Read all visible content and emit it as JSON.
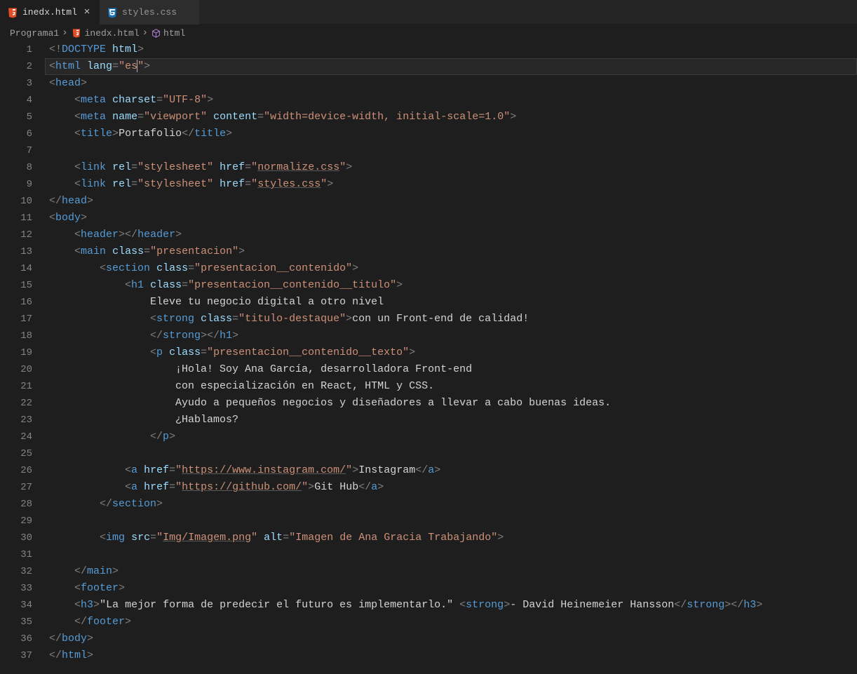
{
  "tabs": [
    {
      "label": "inedx.html",
      "active": true,
      "icon": "html5"
    },
    {
      "label": "styles.css",
      "active": false,
      "icon": "css3"
    }
  ],
  "breadcrumbs": {
    "parts": [
      "Programa1",
      "inedx.html",
      "html"
    ]
  },
  "code": {
    "lines": [
      {
        "n": 1,
        "indent": 0,
        "segs": [
          [
            "p",
            "<!"
          ],
          [
            "tag",
            "DOCTYPE"
          ],
          [
            "txt",
            " "
          ],
          [
            "attr",
            "html"
          ],
          [
            "p",
            ">"
          ]
        ]
      },
      {
        "n": 2,
        "indent": 0,
        "hl": true,
        "segs": [
          [
            "p",
            "<"
          ],
          [
            "tag",
            "html"
          ],
          [
            "txt",
            " "
          ],
          [
            "attr",
            "lang"
          ],
          [
            "p",
            "="
          ],
          [
            "str",
            "\"es"
          ],
          [
            "caret",
            ""
          ],
          [
            "str",
            "\""
          ],
          [
            "p",
            ">"
          ]
        ]
      },
      {
        "n": 3,
        "indent": 0,
        "segs": [
          [
            "p",
            "<"
          ],
          [
            "tag",
            "head"
          ],
          [
            "p",
            ">"
          ]
        ]
      },
      {
        "n": 4,
        "indent": 1,
        "segs": [
          [
            "p",
            "<"
          ],
          [
            "tag",
            "meta"
          ],
          [
            "txt",
            " "
          ],
          [
            "attr",
            "charset"
          ],
          [
            "p",
            "="
          ],
          [
            "str",
            "\"UTF-8\""
          ],
          [
            "p",
            ">"
          ]
        ]
      },
      {
        "n": 5,
        "indent": 1,
        "segs": [
          [
            "p",
            "<"
          ],
          [
            "tag",
            "meta"
          ],
          [
            "txt",
            " "
          ],
          [
            "attr",
            "name"
          ],
          [
            "p",
            "="
          ],
          [
            "str",
            "\"viewport\""
          ],
          [
            "txt",
            " "
          ],
          [
            "attr",
            "content"
          ],
          [
            "p",
            "="
          ],
          [
            "str",
            "\"width=device-width, initial-scale=1.0\""
          ],
          [
            "p",
            ">"
          ]
        ]
      },
      {
        "n": 6,
        "indent": 1,
        "segs": [
          [
            "p",
            "<"
          ],
          [
            "tag",
            "title"
          ],
          [
            "p",
            ">"
          ],
          [
            "txt",
            "Portafolio"
          ],
          [
            "p",
            "</"
          ],
          [
            "tag",
            "title"
          ],
          [
            "p",
            ">"
          ]
        ]
      },
      {
        "n": 7,
        "indent": 0,
        "segs": []
      },
      {
        "n": 8,
        "indent": 1,
        "segs": [
          [
            "p",
            "<"
          ],
          [
            "tag",
            "link"
          ],
          [
            "txt",
            " "
          ],
          [
            "attr",
            "rel"
          ],
          [
            "p",
            "="
          ],
          [
            "str",
            "\"stylesheet\""
          ],
          [
            "txt",
            " "
          ],
          [
            "attr",
            "href"
          ],
          [
            "p",
            "="
          ],
          [
            "str",
            "\""
          ],
          [
            "link",
            "normalize.css"
          ],
          [
            "str",
            "\""
          ],
          [
            "p",
            ">"
          ]
        ]
      },
      {
        "n": 9,
        "indent": 1,
        "segs": [
          [
            "p",
            "<"
          ],
          [
            "tag",
            "link"
          ],
          [
            "txt",
            " "
          ],
          [
            "attr",
            "rel"
          ],
          [
            "p",
            "="
          ],
          [
            "str",
            "\"stylesheet\""
          ],
          [
            "txt",
            " "
          ],
          [
            "attr",
            "href"
          ],
          [
            "p",
            "="
          ],
          [
            "str",
            "\""
          ],
          [
            "link",
            "styles.css"
          ],
          [
            "str",
            "\""
          ],
          [
            "p",
            ">"
          ]
        ]
      },
      {
        "n": 10,
        "indent": 0,
        "segs": [
          [
            "p",
            "</"
          ],
          [
            "tag",
            "head"
          ],
          [
            "p",
            ">"
          ]
        ]
      },
      {
        "n": 11,
        "indent": 0,
        "segs": [
          [
            "p",
            "<"
          ],
          [
            "tag",
            "body"
          ],
          [
            "p",
            ">"
          ]
        ]
      },
      {
        "n": 12,
        "indent": 1,
        "segs": [
          [
            "p",
            "<"
          ],
          [
            "tag",
            "header"
          ],
          [
            "p",
            "></"
          ],
          [
            "tag",
            "header"
          ],
          [
            "p",
            ">"
          ]
        ]
      },
      {
        "n": 13,
        "indent": 1,
        "segs": [
          [
            "p",
            "<"
          ],
          [
            "tag",
            "main"
          ],
          [
            "txt",
            " "
          ],
          [
            "attr",
            "class"
          ],
          [
            "p",
            "="
          ],
          [
            "str",
            "\"presentacion\""
          ],
          [
            "p",
            ">"
          ]
        ]
      },
      {
        "n": 14,
        "indent": 2,
        "segs": [
          [
            "p",
            "<"
          ],
          [
            "tag",
            "section"
          ],
          [
            "txt",
            " "
          ],
          [
            "attr",
            "class"
          ],
          [
            "p",
            "="
          ],
          [
            "str",
            "\"presentacion__contenido\""
          ],
          [
            "p",
            ">"
          ]
        ]
      },
      {
        "n": 15,
        "indent": 3,
        "segs": [
          [
            "p",
            "<"
          ],
          [
            "tag",
            "h1"
          ],
          [
            "txt",
            " "
          ],
          [
            "attr",
            "class"
          ],
          [
            "p",
            "="
          ],
          [
            "str",
            "\"presentacion__contenido__titulo\""
          ],
          [
            "p",
            ">"
          ]
        ]
      },
      {
        "n": 16,
        "indent": 4,
        "segs": [
          [
            "txt",
            "Eleve tu negocio digital a otro nivel"
          ]
        ]
      },
      {
        "n": 17,
        "indent": 4,
        "segs": [
          [
            "p",
            "<"
          ],
          [
            "tag",
            "strong"
          ],
          [
            "txt",
            " "
          ],
          [
            "attr",
            "class"
          ],
          [
            "p",
            "="
          ],
          [
            "str",
            "\"titulo-destaque\""
          ],
          [
            "p",
            ">"
          ],
          [
            "txt",
            "con un Front-end de calidad!"
          ]
        ]
      },
      {
        "n": 18,
        "indent": 4,
        "segs": [
          [
            "p",
            "</"
          ],
          [
            "tag",
            "strong"
          ],
          [
            "p",
            "></"
          ],
          [
            "tag",
            "h1"
          ],
          [
            "p",
            ">"
          ]
        ]
      },
      {
        "n": 19,
        "indent": 4,
        "segs": [
          [
            "p",
            "<"
          ],
          [
            "tag",
            "p"
          ],
          [
            "txt",
            " "
          ],
          [
            "attr",
            "class"
          ],
          [
            "p",
            "="
          ],
          [
            "str",
            "\"presentacion__contenido__texto\""
          ],
          [
            "p",
            ">"
          ]
        ]
      },
      {
        "n": 20,
        "indent": 5,
        "segs": [
          [
            "txt",
            "¡Hola! Soy Ana García, desarrolladora Front-end"
          ]
        ]
      },
      {
        "n": 21,
        "indent": 5,
        "segs": [
          [
            "txt",
            "con especialización en React, HTML y CSS."
          ]
        ]
      },
      {
        "n": 22,
        "indent": 5,
        "segs": [
          [
            "txt",
            "Ayudo a pequeños negocios y diseñadores a llevar a cabo buenas ideas."
          ]
        ]
      },
      {
        "n": 23,
        "indent": 5,
        "segs": [
          [
            "txt",
            "¿Hablamos?"
          ]
        ]
      },
      {
        "n": 24,
        "indent": 4,
        "segs": [
          [
            "p",
            "</"
          ],
          [
            "tag",
            "p"
          ],
          [
            "p",
            ">"
          ]
        ]
      },
      {
        "n": 25,
        "indent": 0,
        "segs": []
      },
      {
        "n": 26,
        "indent": 3,
        "segs": [
          [
            "p",
            "<"
          ],
          [
            "tag",
            "a"
          ],
          [
            "txt",
            " "
          ],
          [
            "attr",
            "href"
          ],
          [
            "p",
            "="
          ],
          [
            "str",
            "\""
          ],
          [
            "link",
            "https://www.instagram.com/"
          ],
          [
            "str",
            "\""
          ],
          [
            "p",
            ">"
          ],
          [
            "txt",
            "Instagram"
          ],
          [
            "p",
            "</"
          ],
          [
            "tag",
            "a"
          ],
          [
            "p",
            ">"
          ]
        ]
      },
      {
        "n": 27,
        "indent": 3,
        "segs": [
          [
            "p",
            "<"
          ],
          [
            "tag",
            "a"
          ],
          [
            "txt",
            " "
          ],
          [
            "attr",
            "href"
          ],
          [
            "p",
            "="
          ],
          [
            "str",
            "\""
          ],
          [
            "link",
            "https://github.com/"
          ],
          [
            "str",
            "\""
          ],
          [
            "p",
            ">"
          ],
          [
            "txt",
            "Git Hub"
          ],
          [
            "p",
            "</"
          ],
          [
            "tag",
            "a"
          ],
          [
            "p",
            ">"
          ]
        ]
      },
      {
        "n": 28,
        "indent": 2,
        "segs": [
          [
            "p",
            "</"
          ],
          [
            "tag",
            "section"
          ],
          [
            "p",
            ">"
          ]
        ]
      },
      {
        "n": 29,
        "indent": 0,
        "segs": []
      },
      {
        "n": 30,
        "indent": 2,
        "segs": [
          [
            "p",
            "<"
          ],
          [
            "tag",
            "img"
          ],
          [
            "txt",
            " "
          ],
          [
            "attr",
            "src"
          ],
          [
            "p",
            "="
          ],
          [
            "str",
            "\""
          ],
          [
            "link",
            "Img/Imagem.png"
          ],
          [
            "str",
            "\""
          ],
          [
            "txt",
            " "
          ],
          [
            "attr",
            "alt"
          ],
          [
            "p",
            "="
          ],
          [
            "str",
            "\"Imagen de Ana Gracia Trabajando\""
          ],
          [
            "p",
            ">"
          ]
        ]
      },
      {
        "n": 31,
        "indent": 0,
        "segs": []
      },
      {
        "n": 32,
        "indent": 1,
        "segs": [
          [
            "p",
            "</"
          ],
          [
            "tag",
            "main"
          ],
          [
            "p",
            ">"
          ]
        ]
      },
      {
        "n": 33,
        "indent": 1,
        "segs": [
          [
            "p",
            "<"
          ],
          [
            "tag",
            "footer"
          ],
          [
            "p",
            ">"
          ]
        ]
      },
      {
        "n": 34,
        "indent": 1,
        "segs": [
          [
            "p",
            "<"
          ],
          [
            "tag",
            "h3"
          ],
          [
            "p",
            ">"
          ],
          [
            "txt",
            "\"La mejor forma de predecir el futuro es implementarlo.\" "
          ],
          [
            "p",
            "<"
          ],
          [
            "tag",
            "strong"
          ],
          [
            "p",
            ">"
          ],
          [
            "txt",
            "- David Heinemeier Hansson"
          ],
          [
            "p",
            "</"
          ],
          [
            "tag",
            "strong"
          ],
          [
            "p",
            "></"
          ],
          [
            "tag",
            "h3"
          ],
          [
            "p",
            ">"
          ]
        ]
      },
      {
        "n": 35,
        "indent": 1,
        "segs": [
          [
            "p",
            "</"
          ],
          [
            "tag",
            "footer"
          ],
          [
            "p",
            ">"
          ]
        ]
      },
      {
        "n": 36,
        "indent": 0,
        "segs": [
          [
            "p",
            "</"
          ],
          [
            "tag",
            "body"
          ],
          [
            "p",
            ">"
          ]
        ]
      },
      {
        "n": 37,
        "indent": 0,
        "segs": [
          [
            "p",
            "</"
          ],
          [
            "tag",
            "html"
          ],
          [
            "p",
            ">"
          ]
        ]
      }
    ]
  }
}
